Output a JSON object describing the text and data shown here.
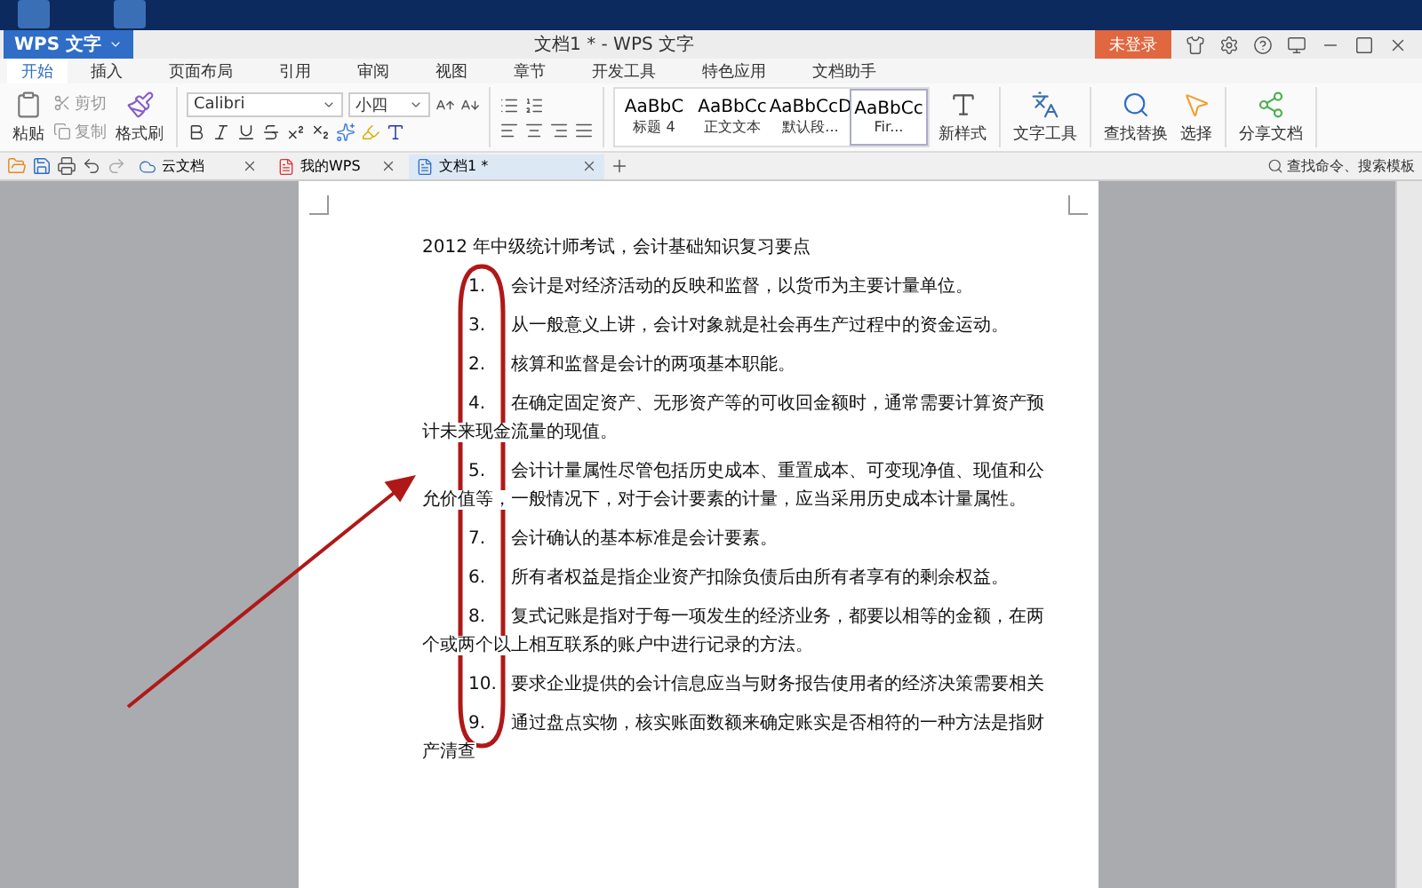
{
  "app_button": {
    "label": "WPS 文字"
  },
  "window": {
    "title": "文档1 * - WPS 文字"
  },
  "login_button": {
    "label": "未登录"
  },
  "menu_tabs": [
    {
      "label": "开始",
      "selected": true
    },
    {
      "label": "插入",
      "selected": false
    },
    {
      "label": "页面布局",
      "selected": false
    },
    {
      "label": "引用",
      "selected": false
    },
    {
      "label": "审阅",
      "selected": false
    },
    {
      "label": "视图",
      "selected": false
    },
    {
      "label": "章节",
      "selected": false
    },
    {
      "label": "开发工具",
      "selected": false
    },
    {
      "label": "特色应用",
      "selected": false
    },
    {
      "label": "文档助手",
      "selected": false
    }
  ],
  "ribbon": {
    "paste": "粘贴",
    "cut": "剪切",
    "copy": "复制",
    "format_painter": "格式刷",
    "font": "Calibri",
    "font_size": "小四",
    "styles": [
      {
        "preview": "AaBbC",
        "name": "标题 4",
        "selected": false
      },
      {
        "preview": "AaBbCc",
        "name": "正文文本",
        "selected": false
      },
      {
        "preview": "AaBbCcD",
        "name": "默认段...",
        "selected": false
      },
      {
        "preview": "AaBbCc",
        "name": "Fir...",
        "selected": true
      }
    ],
    "new_style": "新样式",
    "text_tools": "文字工具",
    "find_replace": "查找替换",
    "select": "选择",
    "share": "分享文档"
  },
  "doc_tabs": [
    {
      "label": "云文档",
      "selected": false
    },
    {
      "label": "我的WPS",
      "selected": false
    },
    {
      "label": "文档1 *",
      "selected": true
    }
  ],
  "search": {
    "placeholder": "查找命令、搜索模板"
  },
  "document": {
    "title": "2012 年中级统计师考试，会计基础知识复习要点",
    "paragraphs": [
      {
        "number": "1.",
        "text": "会计是对经济活动的反映和监督，以货币为主要计量单位。"
      },
      {
        "number": "3.",
        "text": "从一般意义上讲，会计对象就是社会再生产过程中的资金运动。"
      },
      {
        "number": "2.",
        "text": "核算和监督是会计的两项基本职能。"
      },
      {
        "number": "4.",
        "text": "在确定固定资产、无形资产等的可收回金额时，通常需要计算资产预计未来现金流量的现值。"
      },
      {
        "number": "5.",
        "text": "会计计量属性尽管包括历史成本、重置成本、可变现净值、现值和公允价值等，一般情况下，对于会计要素的计量，应当采用历史成本计量属性。"
      },
      {
        "number": "7.",
        "text": "会计确认的基本标准是会计要素。"
      },
      {
        "number": "6.",
        "text": "所有者权益是指企业资产扣除负债后由所有者享有的剩余权益。"
      },
      {
        "number": "8.",
        "text": "复式记账是指对于每一项发生的经济业务，都要以相等的金额，在两个或两个以上相互联系的账户中进行记录的方法。"
      },
      {
        "number": "10.",
        "text": "要求企业提供的会计信息应当与财务报告使用者的经济决策需要相关"
      },
      {
        "number": "9.",
        "text": "通过盘点实物，核实账面数额来确定账实是否相符的一种方法是指财产清查"
      }
    ]
  }
}
